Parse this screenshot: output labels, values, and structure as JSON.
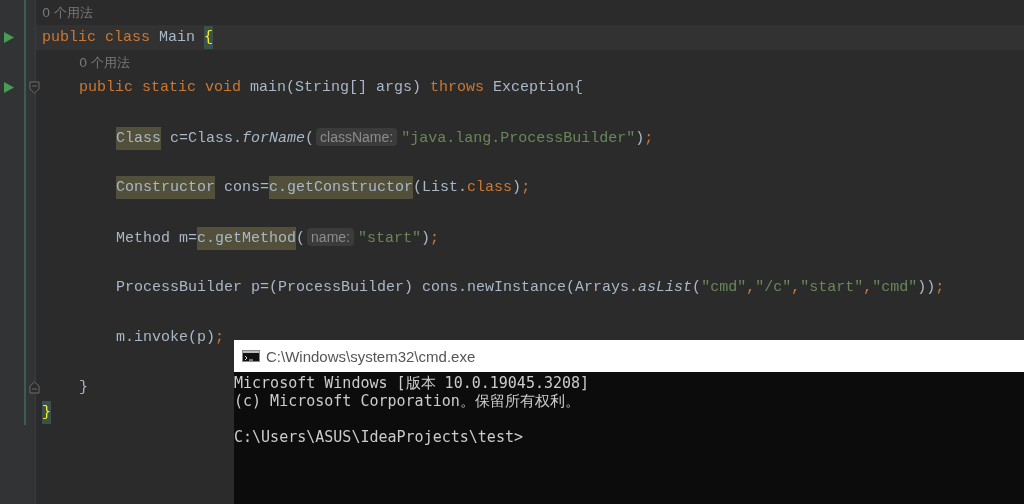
{
  "editor": {
    "lines": [
      {
        "kind": "usage",
        "run": false,
        "current": false,
        "tokens": [
          {
            "text": "0 个用法",
            "kind": "usage"
          }
        ]
      },
      {
        "kind": "code",
        "run": true,
        "current": true,
        "tokens": [
          {
            "text": "public class ",
            "kind": "keyword"
          },
          {
            "text": "Main ",
            "kind": "plain"
          },
          {
            "text": "{",
            "kind": "brace_match"
          }
        ],
        "children": [
          {
            "kind": "usage",
            "run": false,
            "current": false,
            "tokens": [
              {
                "text": "0 个用法",
                "kind": "usage"
              }
            ]
          },
          {
            "kind": "code",
            "run": true,
            "current": false,
            "fold_start": true,
            "tokens": [
              {
                "text": "public static void ",
                "kind": "keyword"
              },
              {
                "text": "main(String[] args) ",
                "kind": "plain"
              },
              {
                "text": "throws ",
                "kind": "keyword"
              },
              {
                "text": "Exception{",
                "kind": "plain"
              }
            ],
            "children": [
              {
                "kind": "blank",
                "run": false,
                "current": false
              },
              {
                "kind": "code",
                "run": false,
                "current": false,
                "tokens": [
                  {
                    "text": "Class",
                    "kind": "usage_highlight"
                  },
                  {
                    "text": " c=Class.",
                    "kind": "plain"
                  },
                  {
                    "text": "forName",
                    "kind": "static_call"
                  },
                  {
                    "text": "(",
                    "kind": "plain"
                  },
                  {
                    "text": "className:",
                    "kind": "hint"
                  },
                  {
                    "text": "\"java.lang.ProcessBuilder\"",
                    "kind": "string"
                  },
                  {
                    "text": ")",
                    "kind": "plain"
                  },
                  {
                    "text": ";",
                    "kind": "keyword"
                  }
                ]
              },
              {
                "kind": "blank",
                "run": false,
                "current": false
              },
              {
                "kind": "code",
                "run": false,
                "current": false,
                "tokens": [
                  {
                    "text": "Constructor",
                    "kind": "usage_highlight"
                  },
                  {
                    "text": " cons=",
                    "kind": "plain"
                  },
                  {
                    "text": "c.getConstructor",
                    "kind": "usage_highlight"
                  },
                  {
                    "text": "(List.",
                    "kind": "plain"
                  },
                  {
                    "text": "class",
                    "kind": "keyword"
                  },
                  {
                    "text": ")",
                    "kind": "plain"
                  },
                  {
                    "text": ";",
                    "kind": "keyword"
                  }
                ]
              },
              {
                "kind": "blank",
                "run": false,
                "current": false
              },
              {
                "kind": "code",
                "run": false,
                "current": false,
                "tokens": [
                  {
                    "text": "Method m=",
                    "kind": "plain"
                  },
                  {
                    "text": "c.getMethod",
                    "kind": "usage_highlight"
                  },
                  {
                    "text": "(",
                    "kind": "plain"
                  },
                  {
                    "text": "name:",
                    "kind": "hint"
                  },
                  {
                    "text": "\"start\"",
                    "kind": "string"
                  },
                  {
                    "text": ")",
                    "kind": "plain"
                  },
                  {
                    "text": ";",
                    "kind": "keyword"
                  }
                ]
              },
              {
                "kind": "blank",
                "run": false,
                "current": false
              },
              {
                "kind": "code",
                "run": false,
                "current": false,
                "tokens": [
                  {
                    "text": "ProcessBuilder p=(ProcessBuilder) cons.newInstance(Arrays.",
                    "kind": "plain"
                  },
                  {
                    "text": "asList",
                    "kind": "static_call"
                  },
                  {
                    "text": "(",
                    "kind": "plain"
                  },
                  {
                    "text": "\"cmd\"",
                    "kind": "string"
                  },
                  {
                    "text": ",",
                    "kind": "keyword"
                  },
                  {
                    "text": "\"/c\"",
                    "kind": "string"
                  },
                  {
                    "text": ",",
                    "kind": "keyword"
                  },
                  {
                    "text": "\"start\"",
                    "kind": "string"
                  },
                  {
                    "text": ",",
                    "kind": "keyword"
                  },
                  {
                    "text": "\"cmd\"",
                    "kind": "string"
                  },
                  {
                    "text": "))",
                    "kind": "plain"
                  },
                  {
                    "text": ";",
                    "kind": "keyword"
                  }
                ]
              },
              {
                "kind": "blank",
                "run": false,
                "current": false
              },
              {
                "kind": "code",
                "run": false,
                "current": false,
                "tokens": [
                  {
                    "text": "m.invoke(p)",
                    "kind": "plain"
                  },
                  {
                    "text": ";",
                    "kind": "keyword"
                  }
                ]
              },
              {
                "kind": "blank",
                "run": false,
                "current": false
              }
            ]
          },
          {
            "kind": "code",
            "run": false,
            "current": false,
            "fold_end": true,
            "tokens": [
              {
                "text": "}",
                "kind": "plain"
              }
            ]
          }
        ]
      },
      {
        "kind": "code",
        "run": false,
        "current": false,
        "tokens": [
          {
            "text": "}",
            "kind": "brace_match"
          }
        ]
      }
    ]
  },
  "console": {
    "title": "C:\\Windows\\system32\\cmd.exe",
    "output": [
      "Microsoft Windows [版本 10.0.19045.3208]",
      "(c) Microsoft Corporation。保留所有权利。"
    ],
    "prompt": "C:\\Users\\ASUS\\IdeaProjects\\test>"
  }
}
